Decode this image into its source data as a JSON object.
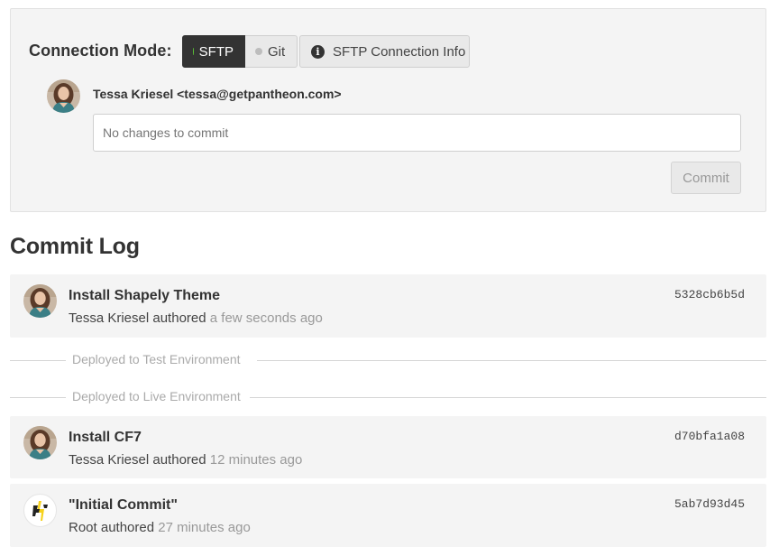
{
  "connection": {
    "label": "Connection Mode:",
    "modes": [
      {
        "label": "SFTP",
        "active": true
      },
      {
        "label": "Git",
        "active": false
      }
    ],
    "info_button": "SFTP Connection Info",
    "author": "Tessa Kriesel <tessa@getpantheon.com>",
    "message_placeholder": "No changes to commit",
    "commit_button": "Commit"
  },
  "commit_log": {
    "title": "Commit Log",
    "entries": [
      {
        "message": "Install Shapely Theme",
        "author": "Tessa Kriesel",
        "verb": "authored",
        "time": "a few seconds ago",
        "hash": "5328cb6b5d",
        "avatar": "user-avatar-icon"
      },
      {
        "message": "Install CF7",
        "author": "Tessa Kriesel",
        "verb": "authored",
        "time": "12 minutes ago",
        "hash": "d70bfa1a08",
        "avatar": "user-avatar-icon"
      },
      {
        "message": "\"Initial Commit\"",
        "author": "Root",
        "verb": "authored",
        "time": "27 minutes ago",
        "hash": "5ab7d93d45",
        "avatar": "pantheon-logo-icon"
      }
    ],
    "deployments": [
      "Deployed to Test Environment",
      "Deployed to Live Environment"
    ]
  },
  "colors": {
    "active_dot": "#5bc236",
    "inactive_dot": "#bdbdbd",
    "active_mode_bg": "#333333",
    "panel_bg": "#f4f4f4"
  }
}
